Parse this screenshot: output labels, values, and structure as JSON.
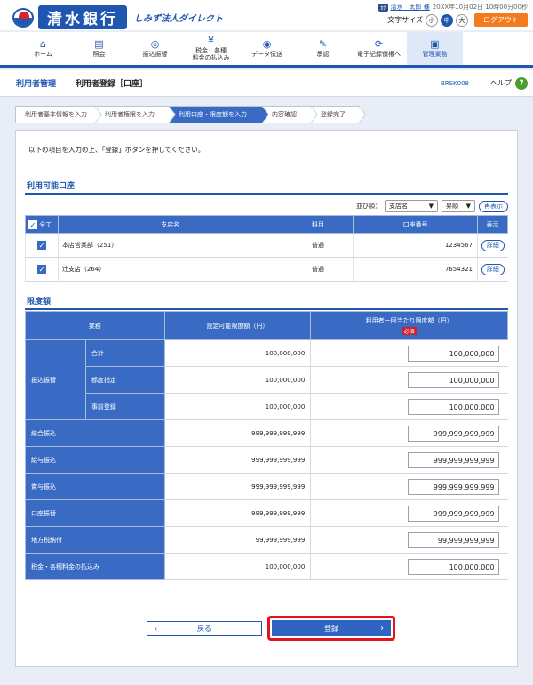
{
  "header": {
    "bank_name": "清水銀行",
    "service_name": "しみず法人ダイレクト",
    "user_badge": "ｶﾅ",
    "user_name": "清水　太郎 様",
    "timestamp": "20XX年10月02日 10時00分00秒",
    "font_size_label": "文字サイズ",
    "font_sizes": [
      "小",
      "中",
      "大"
    ],
    "font_size_selected": "中",
    "logout_label": "ログアウト"
  },
  "nav": {
    "items": [
      {
        "label": "ホーム",
        "icon": "home-icon",
        "glyph": "⌂"
      },
      {
        "label": "照会",
        "icon": "document-icon",
        "glyph": "▤"
      },
      {
        "label": "振込振替",
        "icon": "transfer-icon",
        "glyph": "◎"
      },
      {
        "label": "税金・各種\n料金の払込み",
        "icon": "yen-icon",
        "glyph": "¥"
      },
      {
        "label": "データ伝送",
        "icon": "data-icon",
        "glyph": "◉"
      },
      {
        "label": "承認",
        "icon": "approval-icon",
        "glyph": "✎"
      },
      {
        "label": "電子記録債権へ",
        "icon": "external-icon",
        "glyph": "⟳"
      },
      {
        "label": "管理業務",
        "icon": "admin-icon",
        "glyph": "▣"
      }
    ],
    "active": "管理業務"
  },
  "titlebar": {
    "category": "利用者管理",
    "title": "利用者登録［口座］",
    "screen_code": "BRSK008",
    "help_label": "ヘルプ"
  },
  "steps": [
    {
      "label": "利用者基本情報を入力",
      "active": false
    },
    {
      "label": "利用者権限を入力",
      "active": false
    },
    {
      "label": "利用口座・限度額を入力",
      "active": true
    },
    {
      "label": "内容確認",
      "active": false
    },
    {
      "label": "登録完了",
      "active": false
    }
  ],
  "instruction": "以下の項目を入力の上、「登録」ボタンを押してください。",
  "accounts": {
    "section_title": "利用可能口座",
    "sort_label": "並び順：",
    "sort_field": "支店名",
    "sort_order": "昇順",
    "redisplay_label": "再表示",
    "headers": {
      "all": "全て",
      "branch": "支店名",
      "type": "科目",
      "number": "口座番号",
      "view": "表示"
    },
    "rows": [
      {
        "checked": true,
        "branch": "本店営業部（251）",
        "type": "普通",
        "number": "1234567",
        "detail": "詳細"
      },
      {
        "checked": true,
        "branch": "辻支店（264）",
        "type": "普通",
        "number": "7654321",
        "detail": "詳細"
      }
    ]
  },
  "limits": {
    "section_title": "限度額",
    "headers": {
      "business": "業務",
      "settable": "設定可能限度額（円）",
      "user_limit": "利用者一回当たり限度額（円）",
      "required": "必須"
    },
    "transfer_group": "振込振替",
    "transfer_rows": [
      {
        "label": "合計",
        "settable": "100,000,000",
        "value": "100,000,000"
      },
      {
        "label": "都度指定",
        "settable": "100,000,000",
        "value": "100,000,000"
      },
      {
        "label": "事前登録",
        "settable": "100,000,000",
        "value": "100,000,000"
      }
    ],
    "rows": [
      {
        "label": "総合振込",
        "settable": "999,999,999,999",
        "value": "999,999,999,999"
      },
      {
        "label": "給与振込",
        "settable": "999,999,999,999",
        "value": "999,999,999,999"
      },
      {
        "label": "賞与振込",
        "settable": "999,999,999,999",
        "value": "999,999,999,999"
      },
      {
        "label": "口座振替",
        "settable": "999,999,999,999",
        "value": "999,999,999,999"
      },
      {
        "label": "地方税納付",
        "settable": "99,999,999,999",
        "value": "99,999,999,999"
      },
      {
        "label": "税金・各種料金の払込み",
        "settable": "100,000,000",
        "value": "100,000,000"
      }
    ]
  },
  "buttons": {
    "back_label": "戻る",
    "register_label": "登録"
  }
}
